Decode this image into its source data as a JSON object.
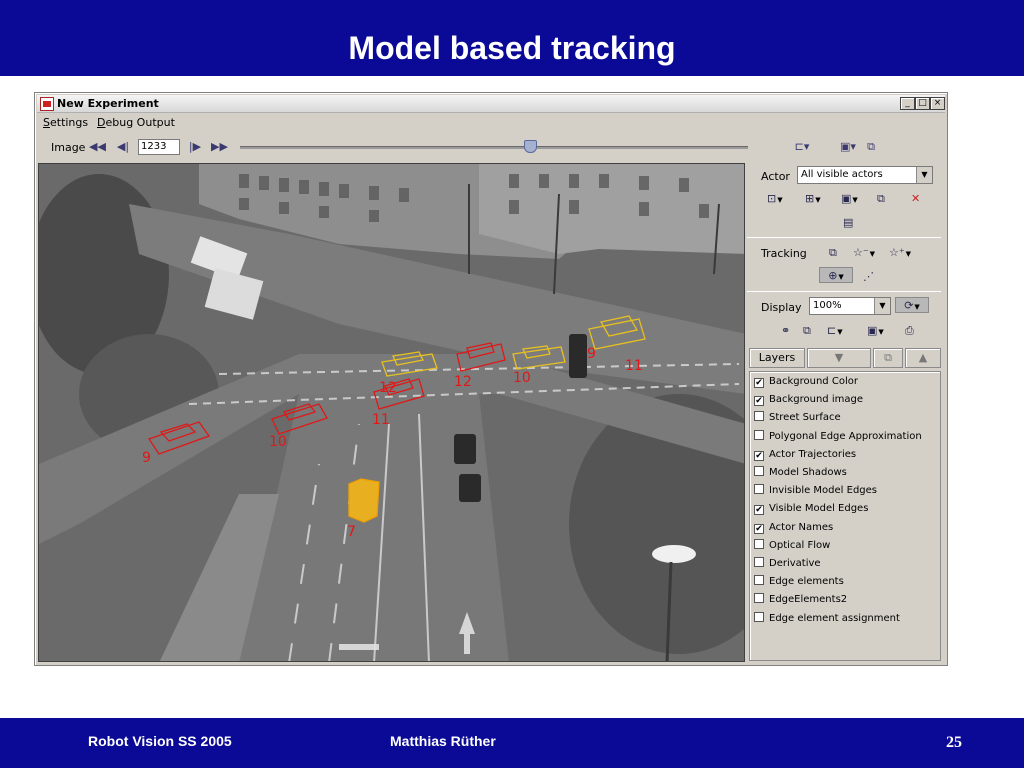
{
  "slide": {
    "title": "Model based tracking",
    "footer_left": "Robot Vision SS 2005",
    "footer_center": "Matthias Rüther",
    "page_number": "25"
  },
  "window": {
    "title": "New Experiment",
    "minimize": "_",
    "maximize": "□",
    "close": "×"
  },
  "menu": {
    "settings": "Settings",
    "debug_output": "Debug Output"
  },
  "toolbar": {
    "image_label": "Image",
    "frame_value": "1233",
    "slider_position": 0.57
  },
  "panel": {
    "actor_label": "Actor",
    "actor_selected": "All visible actors",
    "tracking_label": "Tracking",
    "display_label": "Display",
    "display_zoom": "100%"
  },
  "layers": {
    "title": "Layers",
    "items": [
      {
        "label": "Background Color",
        "checked": true
      },
      {
        "label": "Background image",
        "checked": true
      },
      {
        "label": "Street Surface",
        "checked": false
      },
      {
        "label": "Polygonal Edge Approximation",
        "checked": false
      },
      {
        "label": "Actor Trajectories",
        "checked": true
      },
      {
        "label": "Model Shadows",
        "checked": false
      },
      {
        "label": "Invisible Model Edges",
        "checked": false
      },
      {
        "label": "Visible Model Edges",
        "checked": true
      },
      {
        "label": "Actor Names",
        "checked": true
      },
      {
        "label": "Optical Flow",
        "checked": false
      },
      {
        "label": "Derivative",
        "checked": false
      },
      {
        "label": "Edge elements",
        "checked": false
      },
      {
        "label": "EdgeElements2",
        "checked": false
      },
      {
        "label": "Edge element assignment",
        "checked": false
      }
    ]
  },
  "actors": [
    {
      "id": "9",
      "color": "#e01818"
    },
    {
      "id": "10",
      "color": "#e01818"
    },
    {
      "id": "12",
      "color": "#e01818"
    },
    {
      "id": "11",
      "color": "#e01818"
    },
    {
      "id": "12",
      "color": "#e01818"
    },
    {
      "id": "10",
      "color": "#e01818"
    },
    {
      "id": "9",
      "color": "#e01818"
    },
    {
      "id": "11",
      "color": "#e01818"
    },
    {
      "id": "7",
      "color": "#e01818"
    }
  ],
  "colors": {
    "slide_blue": "#0a0a96",
    "tracked_red": "#e01818",
    "tracked_yellow": "#e8c020",
    "tracked_orange": "#f0a000"
  }
}
